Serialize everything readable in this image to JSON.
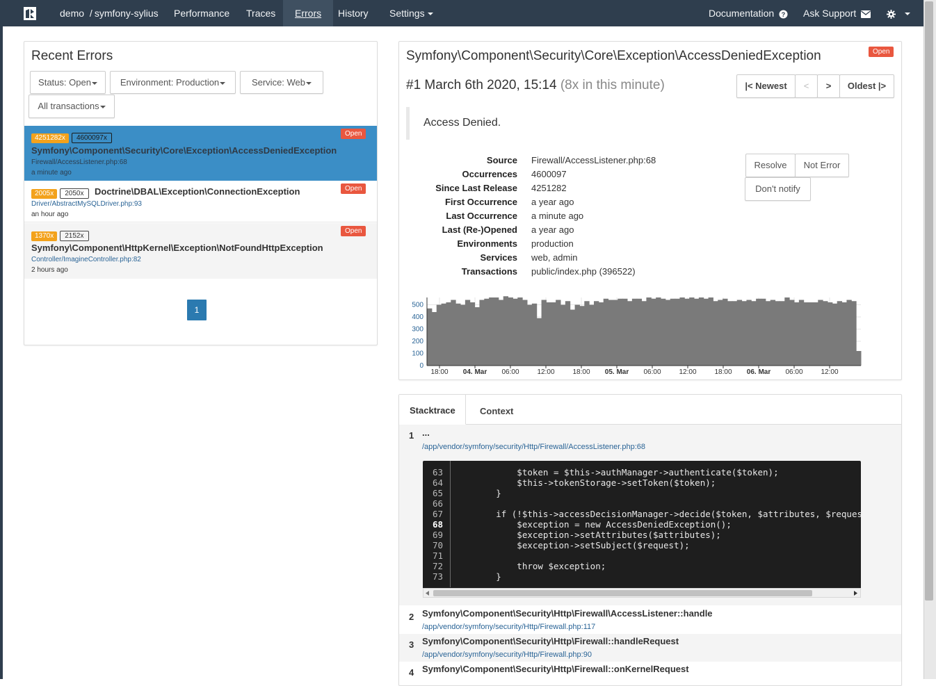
{
  "nav": {
    "project": "demo",
    "sep": "/",
    "app": "symfony-sylius",
    "items": [
      "Performance",
      "Traces",
      "Errors",
      "History",
      "Settings"
    ],
    "active": "Errors",
    "documentation": "Documentation",
    "ask_support": "Ask Support"
  },
  "left": {
    "title": "Recent Errors",
    "filters": [
      "Status: Open",
      "Environment: Production",
      "Service: Web",
      "All transactions"
    ],
    "errors": [
      {
        "badge1": "4251282x",
        "badge2": "4600097x",
        "status": "Open",
        "title": "Symfony\\Component\\Security\\Core\\Exception\\AccessDeniedException",
        "file": "Firewall/AccessListener.php:68",
        "time": "a minute ago",
        "selected": true
      },
      {
        "badge1": "2005x",
        "badge2": "2050x",
        "status": "Open",
        "title": "Doctrine\\DBAL\\Exception\\ConnectionException",
        "file": "Driver/AbstractMySQLDriver.php:93",
        "time": "an hour ago",
        "selected": false
      },
      {
        "badge1": "1370x",
        "badge2": "2152x",
        "status": "Open",
        "title": "Symfony\\Component\\HttpKernel\\Exception\\NotFoundHttpException",
        "file": "Controller/ImagineController.php:82",
        "time": "2 hours ago",
        "selected": false
      }
    ],
    "page": "1"
  },
  "detail": {
    "title": "Symfony\\Component\\Security\\Core\\Exception\\AccessDeniedException",
    "status": "Open",
    "occurrence_num": "#1",
    "occurrence_date": "March 6th 2020, 15:14",
    "occurrence_rate": "(8x in this minute)",
    "pager": {
      "newest": "|< Newest",
      "prev": "<",
      "next": ">",
      "oldest": "Oldest |>"
    },
    "message": "Access Denied.",
    "actions": {
      "resolve": "Resolve",
      "not_error": "Not Error",
      "dont_notify": "Don't notify"
    },
    "fields": [
      {
        "label": "Source",
        "value": "Firewall/AccessListener.php:68"
      },
      {
        "label": "Occurrences",
        "value": "4600097"
      },
      {
        "label": "Since Last Release",
        "value": "4251282"
      },
      {
        "label": "First Occurrence",
        "value": "a year ago"
      },
      {
        "label": "Last Occurrence",
        "value": "a minute ago"
      },
      {
        "label": "Last (Re-)Opened",
        "value": "a year ago"
      },
      {
        "label": "Environments",
        "value": "production"
      },
      {
        "label": "Services",
        "value": "web, admin"
      },
      {
        "label": "Transactions",
        "value": "public/index.php (396522)"
      }
    ]
  },
  "chart_data": {
    "type": "area",
    "x_tick_labels": [
      "18:00",
      "04. Mar",
      "06:00",
      "12:00",
      "18:00",
      "05. Mar",
      "06:00",
      "12:00",
      "18:00",
      "06. Mar",
      "06:00",
      "12:00"
    ],
    "x_tick_bold": [
      false,
      true,
      false,
      false,
      false,
      true,
      false,
      false,
      false,
      true,
      false,
      false
    ],
    "y_ticks": [
      0,
      100,
      200,
      300,
      400,
      500
    ],
    "ylim": [
      0,
      560
    ],
    "values": [
      470,
      440,
      500,
      510,
      520,
      540,
      510,
      500,
      540,
      520,
      480,
      540,
      550,
      560,
      560,
      540,
      570,
      560,
      550,
      560,
      540,
      500,
      510,
      390,
      540,
      520,
      520,
      540,
      500,
      530,
      460,
      500,
      490,
      530,
      500,
      530,
      520,
      550,
      540,
      540,
      550,
      550,
      530,
      550,
      550,
      530,
      560,
      550,
      560,
      550,
      540,
      550,
      550,
      560,
      550,
      560,
      550,
      560,
      550,
      560,
      530,
      540,
      550,
      530,
      530,
      540,
      530,
      540,
      530,
      550,
      550,
      530,
      540,
      530,
      530,
      560,
      540,
      520,
      540,
      520,
      520,
      520,
      540,
      530,
      520,
      510,
      530,
      520,
      540,
      530,
      120
    ],
    "color": "#7a7a7a"
  },
  "tabs": {
    "stacktrace": "Stacktrace",
    "context": "Context"
  },
  "stack": {
    "frame1": {
      "num": "1",
      "fn": "...",
      "path": "/app/vendor/symfony/security/Http/Firewall/AccessListener.php:68"
    },
    "code_lines": [
      {
        "n": "63",
        "text": "            $token = $this->authManager->authenticate($token);"
      },
      {
        "n": "64",
        "text": "            $this->tokenStorage->setToken($token);"
      },
      {
        "n": "65",
        "text": "        }"
      },
      {
        "n": "66",
        "text": ""
      },
      {
        "n": "67",
        "text": "        if (!$this->accessDecisionManager->decide($token, $attributes, $request"
      },
      {
        "n": "68",
        "text": "            $exception = new AccessDeniedException();"
      },
      {
        "n": "69",
        "text": "            $exception->setAttributes($attributes);"
      },
      {
        "n": "70",
        "text": "            $exception->setSubject($request);"
      },
      {
        "n": "71",
        "text": ""
      },
      {
        "n": "72",
        "text": "            throw $exception;"
      },
      {
        "n": "73",
        "text": "        }"
      }
    ],
    "highlight_line": "68",
    "frames": [
      {
        "num": "2",
        "fn": "Symfony\\Component\\Security\\Http\\Firewall\\AccessListener::handle",
        "path": "/app/vendor/symfony/security/Http/Firewall.php:117"
      },
      {
        "num": "3",
        "fn": "Symfony\\Component\\Security\\Http\\Firewall::handleRequest",
        "path": "/app/vendor/symfony/security/Http/Firewall.php:90"
      },
      {
        "num": "4",
        "fn": "Symfony\\Component\\Security\\Http\\Firewall::onKernelRequest",
        "path": ""
      }
    ]
  }
}
